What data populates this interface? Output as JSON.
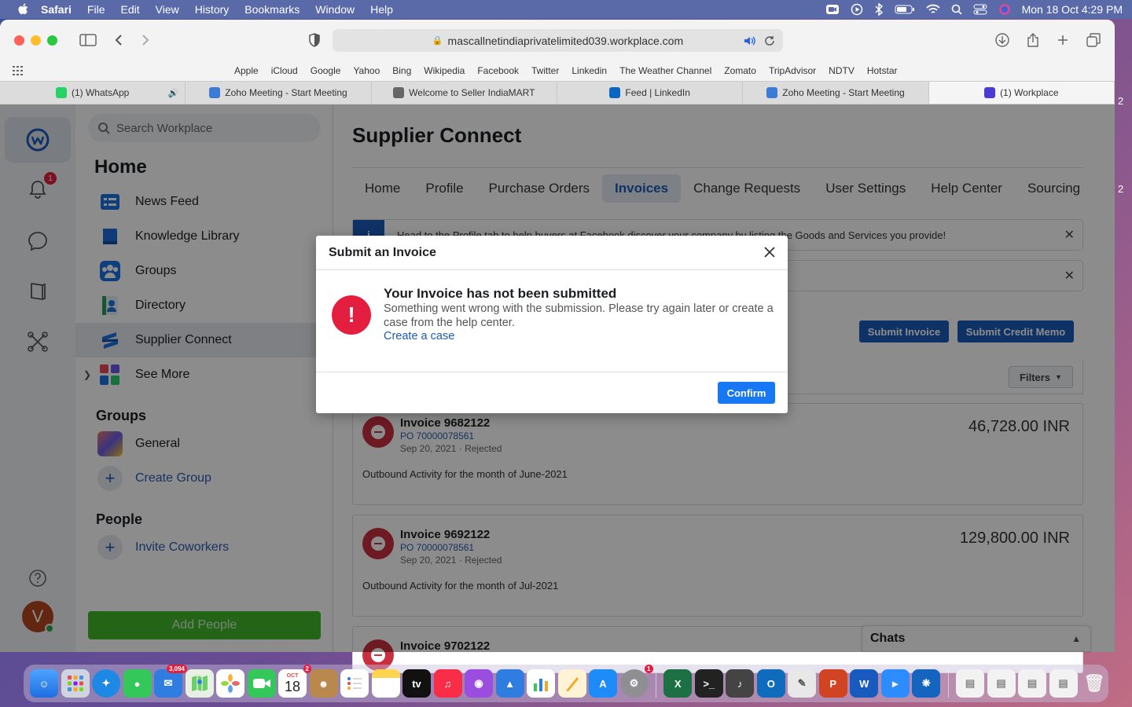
{
  "menubar": {
    "app": "Safari",
    "items": [
      "File",
      "Edit",
      "View",
      "History",
      "Bookmarks",
      "Window",
      "Help"
    ],
    "datetime": "Mon 18 Oct  4:29 PM"
  },
  "browser": {
    "url": "mascallnetindiaprivatelimited039.workplace.com",
    "favorites": [
      "Apple",
      "iCloud",
      "Google",
      "Yahoo",
      "Bing",
      "Wikipedia",
      "Facebook",
      "Twitter",
      "Linkedin",
      "The Weather Channel",
      "Zomato",
      "TripAdvisor",
      "NDTV",
      "Hotstar"
    ],
    "tabs": [
      {
        "label": "(1) WhatsApp",
        "icon": "whatsapp-icon",
        "color": "#25d366"
      },
      {
        "label": "Zoho Meeting - Start Meeting",
        "icon": "zoho-icon",
        "color": "#3a7bd5"
      },
      {
        "label": "Welcome to Seller IndiaMART",
        "icon": "indiamart-icon",
        "color": "#666666"
      },
      {
        "label": "Feed | LinkedIn",
        "icon": "linkedin-icon",
        "color": "#0a66c2"
      },
      {
        "label": "Zoho Meeting - Start Meeting",
        "icon": "zoho-icon",
        "color": "#3a7bd5"
      },
      {
        "label": "(1) Workplace",
        "icon": "workplace-icon",
        "color": "#4b3bd6"
      }
    ]
  },
  "rail": {
    "notifications_badge": "1"
  },
  "leftnav": {
    "search_placeholder": "Search Workplace",
    "home_heading": "Home",
    "items": [
      "News Feed",
      "Knowledge Library",
      "Groups",
      "Directory",
      "Supplier Connect",
      "See More"
    ],
    "groups_heading": "Groups",
    "groups": [
      "General",
      "Create Group"
    ],
    "people_heading": "People",
    "people": [
      "Invite Coworkers"
    ],
    "add_people": "Add People"
  },
  "main": {
    "title": "Supplier Connect",
    "tabs": [
      "Home",
      "Profile",
      "Purchase Orders",
      "Invoices",
      "Change Requests",
      "User Settings",
      "Help Center",
      "Sourcing"
    ],
    "active_tab": "Invoices",
    "banner1": "Head to the Profile tab to help buyers at Facebook discover your company by listing the Goods and Services you provide!",
    "submit_invoice": "Submit Invoice",
    "submit_credit_memo": "Submit Credit Memo",
    "filters": "Filters",
    "invoices": [
      {
        "number": "Invoice 9682122",
        "po": "PO 70000078561",
        "date": "Sep 20, 2021",
        "status": "Rejected",
        "desc": "Outbound Activity for the month of June-2021",
        "amount": "46,728.00 INR"
      },
      {
        "number": "Invoice 9692122",
        "po": "PO 70000078561",
        "date": "Sep 20, 2021",
        "status": "Rejected",
        "desc": "Outbound Activity for the month of Jul-2021",
        "amount": "129,800.00 INR"
      },
      {
        "number": "Invoice 9702122"
      }
    ],
    "chats": "Chats"
  },
  "modal": {
    "header": "Submit an Invoice",
    "title": "Your Invoice has not been submitted",
    "text": "Something went wrong with the submission. Please try again later or create a case from the help center.",
    "link": "Create a case",
    "confirm": "Confirm"
  },
  "dock": {
    "mail_badge": "3,094",
    "calendar_month": "OCT",
    "calendar_day": "18",
    "calendar_badge": "2",
    "settings_badge": "1"
  },
  "colors": {
    "accent": "#1b5bb8",
    "error": "#e41e3f",
    "reject": "#c8303f",
    "add_people": "#42b72a"
  }
}
